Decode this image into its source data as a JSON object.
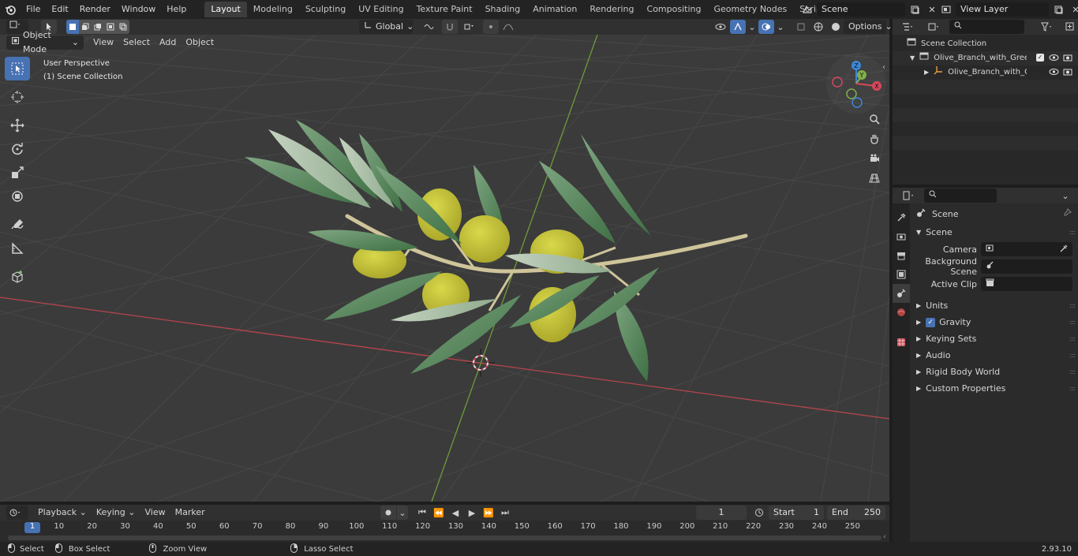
{
  "topbar": {
    "menus": [
      "File",
      "Edit",
      "Render",
      "Window",
      "Help"
    ],
    "workspaces": [
      "Layout",
      "Modeling",
      "Sculpting",
      "UV Editing",
      "Texture Paint",
      "Shading",
      "Animation",
      "Rendering",
      "Compositing",
      "Geometry Nodes",
      "Scripting"
    ],
    "active_workspace": "Layout",
    "add_tab_label": "+",
    "scene_name": "Scene",
    "view_layer": "View Layer"
  },
  "viewport_header": {
    "mode": "Object Mode",
    "menus": [
      "View",
      "Select",
      "Add",
      "Object"
    ],
    "orientation": "Global",
    "options_label": "Options"
  },
  "viewport": {
    "perspective_label": "User Perspective",
    "collection_label": "(1) Scene Collection",
    "gizmo_axes": [
      "Z",
      "Y",
      "X"
    ]
  },
  "outliner": {
    "root": "Scene Collection",
    "items": [
      {
        "label": "Olive_Branch_with_Green_Oli",
        "level": 1
      },
      {
        "label": "Olive_Branch_with_Greer",
        "level": 2
      }
    ]
  },
  "properties": {
    "context_title": "Scene",
    "section_title": "Scene",
    "fields": [
      {
        "label": "Camera",
        "value": ""
      },
      {
        "label": "Background Scene",
        "value": ""
      },
      {
        "label": "Active Clip",
        "value": ""
      }
    ],
    "subpanels": [
      "Units",
      "Gravity",
      "Keying Sets",
      "Audio",
      "Rigid Body World",
      "Custom Properties"
    ],
    "gravity_checked": true
  },
  "timeline": {
    "menus": [
      "Playback",
      "Keying",
      "View",
      "Marker"
    ],
    "current_frame": "1",
    "start_label": "Start",
    "start_value": "1",
    "end_label": "End",
    "end_value": "250",
    "ruler": [
      "1",
      "10",
      "20",
      "30",
      "40",
      "50",
      "60",
      "70",
      "80",
      "90",
      "100",
      "110",
      "120",
      "130",
      "140",
      "150",
      "160",
      "170",
      "180",
      "190",
      "200",
      "210",
      "220",
      "230",
      "240",
      "250"
    ]
  },
  "statusbar": {
    "select": "Select",
    "box_select": "Box Select",
    "zoom_view": "Zoom View",
    "lasso_select": "Lasso Select",
    "version": "2.93.10"
  },
  "colors": {
    "accent": "#4772b3",
    "x_axis": "#d6475d",
    "y_axis": "#7fb04a",
    "z_axis": "#3d86d9"
  }
}
